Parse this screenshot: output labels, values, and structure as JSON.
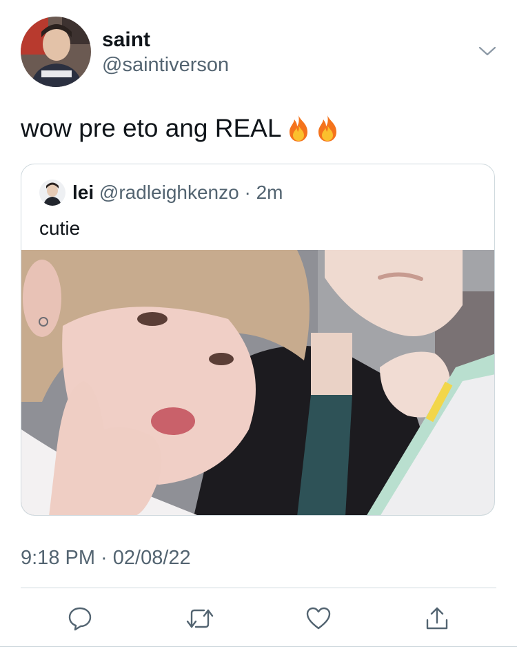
{
  "tweet": {
    "display_name": "saint",
    "handle": "@saintiverson",
    "text": "wow pre eto ang REAL",
    "emojis": [
      "fire-emoji",
      "fire-emoji"
    ],
    "timestamp": "9:18 PM · 02/08/22"
  },
  "quoted_tweet": {
    "display_name": "lei",
    "handle_and_time": "@radleighkenzo · 2m",
    "text": "cutie"
  },
  "icons": {
    "caret": "chevron-down-icon",
    "reply": "reply-icon",
    "retweet": "retweet-icon",
    "like": "heart-icon",
    "share": "share-icon"
  },
  "colors": {
    "text_primary": "#0f1419",
    "text_secondary": "#536471",
    "border": "#cfd9de"
  }
}
